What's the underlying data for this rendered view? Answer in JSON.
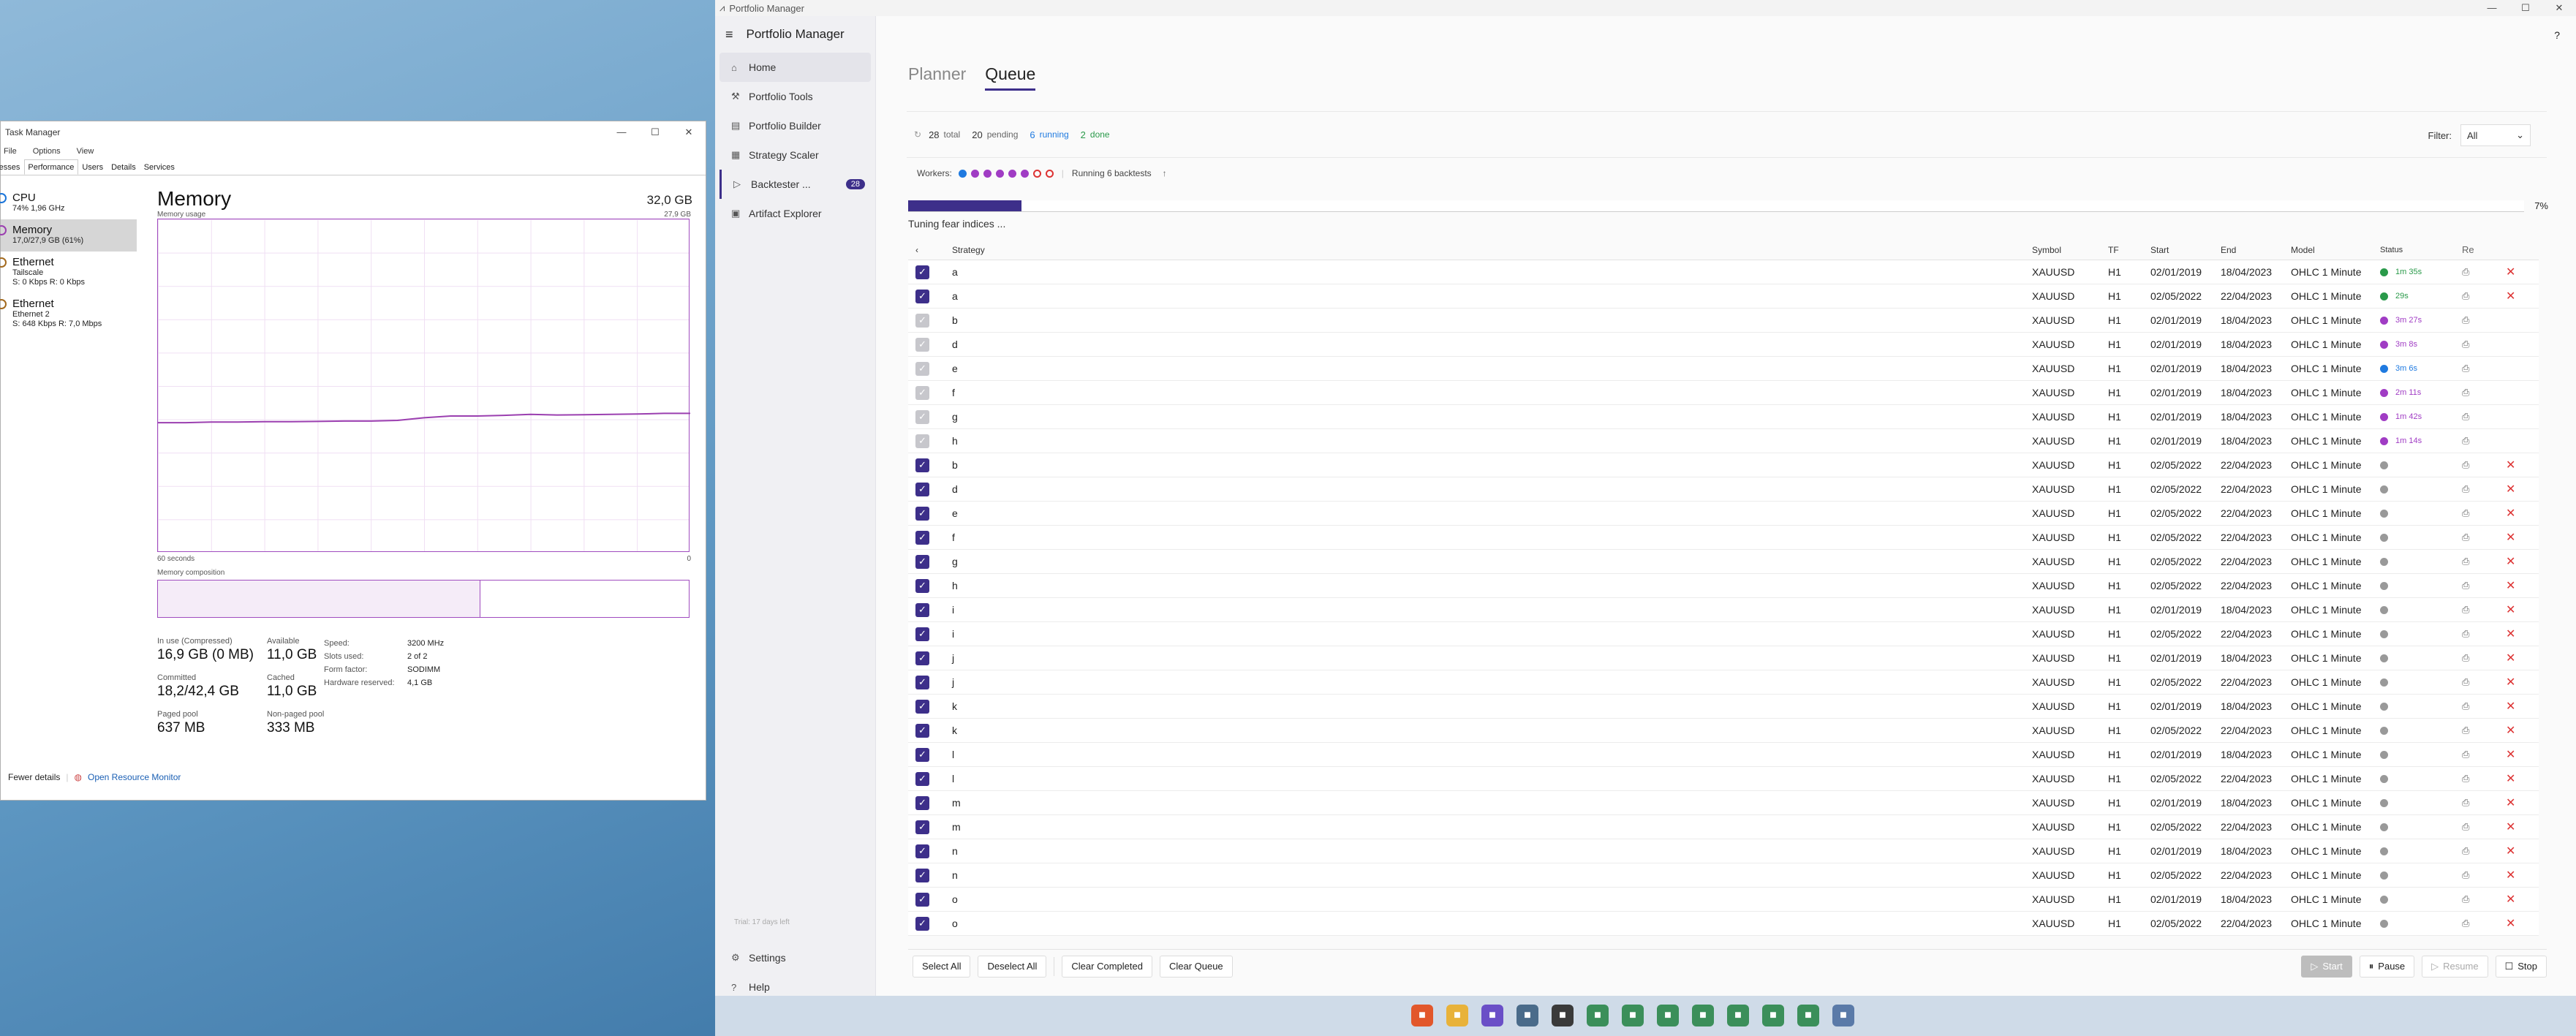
{
  "task_manager": {
    "title": "Task Manager",
    "menu": [
      "File",
      "Options",
      "View"
    ],
    "tabs": [
      "Processes",
      "Performance",
      "Users",
      "Details",
      "Services"
    ],
    "active_tab": "Performance",
    "side": [
      {
        "name": "CPU",
        "sub1": "74% 1,96 GHz",
        "sub2": ""
      },
      {
        "name": "Memory",
        "sub1": "17,0/27,9 GB (61%)",
        "sub2": ""
      },
      {
        "name": "Ethernet",
        "sub1": "Tailscale",
        "sub2": "S: 0 Kbps R: 0 Kbps"
      },
      {
        "name": "Ethernet",
        "sub1": "Ethernet 2",
        "sub2": "S: 648 Kbps R: 7,0 Mbps"
      }
    ],
    "title_main": "Memory",
    "total": "32,0 GB",
    "usage_label": "Memory usage",
    "usage_max": "27,9 GB",
    "axis_left": "60 seconds",
    "axis_right": "0",
    "composition_label": "Memory composition",
    "in_use_label": "In use (Compressed)",
    "in_use": "16,9 GB (0 MB)",
    "available_label": "Available",
    "available": "11,0 GB",
    "committed_label": "Committed",
    "committed": "18,2/42,4 GB",
    "cached_label": "Cached",
    "cached": "11,0 GB",
    "paged_label": "Paged pool",
    "paged": "637 MB",
    "nonpaged_label": "Non-paged pool",
    "nonpaged": "333 MB",
    "kv": [
      {
        "k": "Speed:",
        "v": "3200 MHz"
      },
      {
        "k": "Slots used:",
        "v": "2 of 2"
      },
      {
        "k": "Form factor:",
        "v": "SODIMM"
      },
      {
        "k": "Hardware reserved:",
        "v": "4,1 GB"
      }
    ],
    "fewer_details": "Fewer details",
    "resource_monitor": "Open Resource Monitor",
    "usage_trace": [
      0.39,
      0.39,
      0.392,
      0.392,
      0.393,
      0.393,
      0.394,
      0.395,
      0.395,
      0.397,
      0.405,
      0.41,
      0.41,
      0.412,
      0.415,
      0.413,
      0.414,
      0.415,
      0.416,
      0.418,
      0.418
    ]
  },
  "portfolio_manager": {
    "window_title": "Portfolio Manager",
    "app_title": "Portfolio Manager",
    "nav": [
      {
        "label": "Home",
        "icon": "home-icon"
      },
      {
        "label": "Portfolio Tools",
        "icon": "tools-icon"
      },
      {
        "label": "Portfolio Builder",
        "icon": "builder-icon"
      },
      {
        "label": "Strategy Scaler",
        "icon": "scaler-icon"
      },
      {
        "label": "Backtester ...",
        "icon": "play-icon",
        "badge": "28"
      },
      {
        "label": "Artifact Explorer",
        "icon": "folder-icon"
      }
    ],
    "trial": "Trial: 17 days left",
    "settings": "Settings",
    "help": "Help",
    "tabs": [
      "Planner",
      "Queue"
    ],
    "active_tab": "Queue",
    "summary": {
      "total": "28",
      "total_lbl": "total",
      "pending": "20",
      "pending_lbl": "pending",
      "running": "6",
      "running_lbl": "running",
      "done": "2",
      "done_lbl": "done"
    },
    "filter_label": "Filter:",
    "filter_value": "All",
    "workers_label": "Workers:",
    "workers": [
      {
        "color": "#1f7ae0",
        "filled": true
      },
      {
        "color": "#a03cc4",
        "filled": true
      },
      {
        "color": "#a03cc4",
        "filled": true
      },
      {
        "color": "#a03cc4",
        "filled": true
      },
      {
        "color": "#a03cc4",
        "filled": true
      },
      {
        "color": "#a03cc4",
        "filled": true
      },
      {
        "color": "#d33",
        "filled": false
      },
      {
        "color": "#d33",
        "filled": false
      }
    ],
    "running_text": "Running 6 backtests",
    "progress": 0.07,
    "progress_text": "7%",
    "phase": "Tuning fear indices ...",
    "columns": [
      "Strategy",
      "Symbol",
      "TF",
      "Start",
      "End",
      "Model",
      "Status",
      "Re"
    ],
    "rows": [
      {
        "s": "a",
        "sym": "XAUUSD",
        "tf": "H1",
        "start": "02/01/2019",
        "end": "18/04/2023",
        "model": "OHLC 1 Minute",
        "dot": "#2a9a4a",
        "stat": "1m 35s",
        "statc": "#2a9a4a",
        "chk": "on",
        "x": true
      },
      {
        "s": "a",
        "sym": "XAUUSD",
        "tf": "H1",
        "start": "02/05/2022",
        "end": "22/04/2023",
        "model": "OHLC 1 Minute",
        "dot": "#2a9a4a",
        "stat": "29s",
        "statc": "#2a9a4a",
        "chk": "on",
        "x": true
      },
      {
        "s": "b",
        "sym": "XAUUSD",
        "tf": "H1",
        "start": "02/01/2019",
        "end": "18/04/2023",
        "model": "OHLC 1 Minute",
        "dot": "#a03cc4",
        "stat": "3m 27s",
        "statc": "#a03cc4",
        "chk": "dis",
        "x": false
      },
      {
        "s": "d",
        "sym": "XAUUSD",
        "tf": "H1",
        "start": "02/01/2019",
        "end": "18/04/2023",
        "model": "OHLC 1 Minute",
        "dot": "#a03cc4",
        "stat": "3m 8s",
        "statc": "#a03cc4",
        "chk": "dis",
        "x": false
      },
      {
        "s": "e",
        "sym": "XAUUSD",
        "tf": "H1",
        "start": "02/01/2019",
        "end": "18/04/2023",
        "model": "OHLC 1 Minute",
        "dot": "#1f7ae0",
        "stat": "3m 6s",
        "statc": "#1f7ae0",
        "chk": "dis",
        "x": false
      },
      {
        "s": "f",
        "sym": "XAUUSD",
        "tf": "H1",
        "start": "02/01/2019",
        "end": "18/04/2023",
        "model": "OHLC 1 Minute",
        "dot": "#a03cc4",
        "stat": "2m 11s",
        "statc": "#a03cc4",
        "chk": "dis",
        "x": false
      },
      {
        "s": "g",
        "sym": "XAUUSD",
        "tf": "H1",
        "start": "02/01/2019",
        "end": "18/04/2023",
        "model": "OHLC 1 Minute",
        "dot": "#a03cc4",
        "stat": "1m 42s",
        "statc": "#a03cc4",
        "chk": "dis",
        "x": false
      },
      {
        "s": "h",
        "sym": "XAUUSD",
        "tf": "H1",
        "start": "02/01/2019",
        "end": "18/04/2023",
        "model": "OHLC 1 Minute",
        "dot": "#a03cc4",
        "stat": "1m 14s",
        "statc": "#a03cc4",
        "chk": "dis",
        "x": false
      },
      {
        "s": "b",
        "sym": "XAUUSD",
        "tf": "H1",
        "start": "02/05/2022",
        "end": "22/04/2023",
        "model": "OHLC 1 Minute",
        "dot": "#999",
        "stat": "",
        "statc": "#999",
        "chk": "on",
        "x": true
      },
      {
        "s": "d",
        "sym": "XAUUSD",
        "tf": "H1",
        "start": "02/05/2022",
        "end": "22/04/2023",
        "model": "OHLC 1 Minute",
        "dot": "#999",
        "stat": "",
        "statc": "#999",
        "chk": "on",
        "x": true
      },
      {
        "s": "e",
        "sym": "XAUUSD",
        "tf": "H1",
        "start": "02/05/2022",
        "end": "22/04/2023",
        "model": "OHLC 1 Minute",
        "dot": "#999",
        "stat": "",
        "statc": "#999",
        "chk": "on",
        "x": true
      },
      {
        "s": "f",
        "sym": "XAUUSD",
        "tf": "H1",
        "start": "02/05/2022",
        "end": "22/04/2023",
        "model": "OHLC 1 Minute",
        "dot": "#999",
        "stat": "",
        "statc": "#999",
        "chk": "on",
        "x": true
      },
      {
        "s": "g",
        "sym": "XAUUSD",
        "tf": "H1",
        "start": "02/05/2022",
        "end": "22/04/2023",
        "model": "OHLC 1 Minute",
        "dot": "#999",
        "stat": "",
        "statc": "#999",
        "chk": "on",
        "x": true
      },
      {
        "s": "h",
        "sym": "XAUUSD",
        "tf": "H1",
        "start": "02/05/2022",
        "end": "22/04/2023",
        "model": "OHLC 1 Minute",
        "dot": "#999",
        "stat": "",
        "statc": "#999",
        "chk": "on",
        "x": true
      },
      {
        "s": "i",
        "sym": "XAUUSD",
        "tf": "H1",
        "start": "02/01/2019",
        "end": "18/04/2023",
        "model": "OHLC 1 Minute",
        "dot": "#999",
        "stat": "",
        "statc": "#999",
        "chk": "on",
        "x": true
      },
      {
        "s": "i",
        "sym": "XAUUSD",
        "tf": "H1",
        "start": "02/05/2022",
        "end": "22/04/2023",
        "model": "OHLC 1 Minute",
        "dot": "#999",
        "stat": "",
        "statc": "#999",
        "chk": "on",
        "x": true
      },
      {
        "s": "j",
        "sym": "XAUUSD",
        "tf": "H1",
        "start": "02/01/2019",
        "end": "18/04/2023",
        "model": "OHLC 1 Minute",
        "dot": "#999",
        "stat": "",
        "statc": "#999",
        "chk": "on",
        "x": true
      },
      {
        "s": "j",
        "sym": "XAUUSD",
        "tf": "H1",
        "start": "02/05/2022",
        "end": "22/04/2023",
        "model": "OHLC 1 Minute",
        "dot": "#999",
        "stat": "",
        "statc": "#999",
        "chk": "on",
        "x": true
      },
      {
        "s": "k",
        "sym": "XAUUSD",
        "tf": "H1",
        "start": "02/01/2019",
        "end": "18/04/2023",
        "model": "OHLC 1 Minute",
        "dot": "#999",
        "stat": "",
        "statc": "#999",
        "chk": "on",
        "x": true
      },
      {
        "s": "k",
        "sym": "XAUUSD",
        "tf": "H1",
        "start": "02/05/2022",
        "end": "22/04/2023",
        "model": "OHLC 1 Minute",
        "dot": "#999",
        "stat": "",
        "statc": "#999",
        "chk": "on",
        "x": true
      },
      {
        "s": "l",
        "sym": "XAUUSD",
        "tf": "H1",
        "start": "02/01/2019",
        "end": "18/04/2023",
        "model": "OHLC 1 Minute",
        "dot": "#999",
        "stat": "",
        "statc": "#999",
        "chk": "on",
        "x": true
      },
      {
        "s": "l",
        "sym": "XAUUSD",
        "tf": "H1",
        "start": "02/05/2022",
        "end": "22/04/2023",
        "model": "OHLC 1 Minute",
        "dot": "#999",
        "stat": "",
        "statc": "#999",
        "chk": "on",
        "x": true
      },
      {
        "s": "m",
        "sym": "XAUUSD",
        "tf": "H1",
        "start": "02/01/2019",
        "end": "18/04/2023",
        "model": "OHLC 1 Minute",
        "dot": "#999",
        "stat": "",
        "statc": "#999",
        "chk": "on",
        "x": true
      },
      {
        "s": "m",
        "sym": "XAUUSD",
        "tf": "H1",
        "start": "02/05/2022",
        "end": "22/04/2023",
        "model": "OHLC 1 Minute",
        "dot": "#999",
        "stat": "",
        "statc": "#999",
        "chk": "on",
        "x": true
      },
      {
        "s": "n",
        "sym": "XAUUSD",
        "tf": "H1",
        "start": "02/01/2019",
        "end": "18/04/2023",
        "model": "OHLC 1 Minute",
        "dot": "#999",
        "stat": "",
        "statc": "#999",
        "chk": "on",
        "x": true
      },
      {
        "s": "n",
        "sym": "XAUUSD",
        "tf": "H1",
        "start": "02/05/2022",
        "end": "22/04/2023",
        "model": "OHLC 1 Minute",
        "dot": "#999",
        "stat": "",
        "statc": "#999",
        "chk": "on",
        "x": true
      },
      {
        "s": "o",
        "sym": "XAUUSD",
        "tf": "H1",
        "start": "02/01/2019",
        "end": "18/04/2023",
        "model": "OHLC 1 Minute",
        "dot": "#999",
        "stat": "",
        "statc": "#999",
        "chk": "on",
        "x": true
      },
      {
        "s": "o",
        "sym": "XAUUSD",
        "tf": "H1",
        "start": "02/05/2022",
        "end": "22/04/2023",
        "model": "OHLC 1 Minute",
        "dot": "#999",
        "stat": "",
        "statc": "#999",
        "chk": "on",
        "x": true
      }
    ],
    "buttons_left": [
      "Select All",
      "Deselect All",
      "Clear Completed",
      "Clear Queue"
    ],
    "btn_start": "Start",
    "btn_pause": "Pause",
    "btn_resume": "Resume",
    "btn_stop": "Stop"
  },
  "taskbar": {
    "icons": [
      {
        "name": "brave-icon",
        "color": "#e2572b"
      },
      {
        "name": "file-explorer-icon",
        "color": "#e8b23a"
      },
      {
        "name": "app-icon",
        "color": "#6a4fc7"
      },
      {
        "name": "pin-icon",
        "color": "#4a6b8a"
      },
      {
        "name": "portfolio-icon",
        "color": "#3a3a3a"
      },
      {
        "name": "terminal-icon",
        "color": "#3b8f5a"
      },
      {
        "name": "terminal-icon",
        "color": "#3b8f5a"
      },
      {
        "name": "terminal-icon",
        "color": "#3b8f5a"
      },
      {
        "name": "terminal-icon",
        "color": "#3b8f5a"
      },
      {
        "name": "terminal-icon",
        "color": "#3b8f5a"
      },
      {
        "name": "terminal-icon",
        "color": "#3b8f5a"
      },
      {
        "name": "terminal-icon",
        "color": "#3b8f5a"
      },
      {
        "name": "task-manager-icon",
        "color": "#5a7aa8"
      }
    ]
  }
}
